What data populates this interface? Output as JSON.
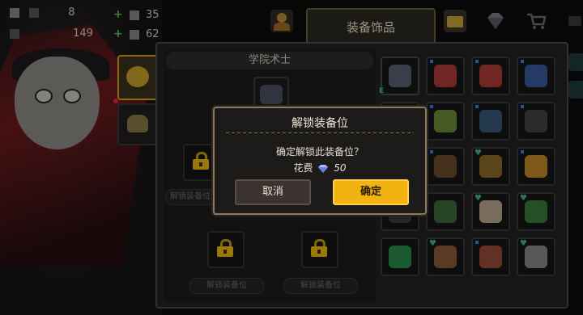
{
  "stats": {
    "left_values": [
      "8",
      "149"
    ],
    "right_values": [
      "35",
      "62"
    ],
    "plus_sign": "+"
  },
  "tabs": {
    "active_label": "装备饰品"
  },
  "hero": {
    "class_name": "学院术士"
  },
  "slots": {
    "unlock_label": "解锁装备位",
    "lock_count": 3
  },
  "dialog": {
    "title": "解锁装备位",
    "message": "确定解锁此装备位？",
    "cost_label": "花费",
    "cost_value": "50",
    "cancel_label": "取消",
    "confirm_label": "确定"
  },
  "grid_badge": "E",
  "icons": [
    "gem-icon",
    "shop-cart-icon",
    "chest-icon",
    "helmet-icon",
    "lock-icon"
  ],
  "colors": {
    "accent": "#f2b312",
    "heart": "#3fbd86",
    "lock": "#f0b90f",
    "cloak": "#7c1a1e"
  }
}
